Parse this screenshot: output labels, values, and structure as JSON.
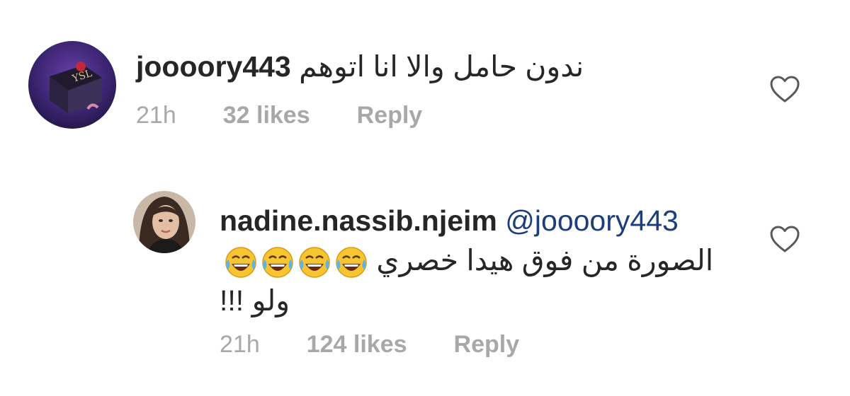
{
  "comments": [
    {
      "username": "joooory443",
      "text": "ندون حامل والا انا اتوهم",
      "time": "21h",
      "likes": "32 likes",
      "reply": "Reply"
    },
    {
      "username": "nadine.nassib.njeim",
      "mention": "@joooory443",
      "text_line1": "الصورة من فوق هيدا خصري",
      "text_line2": "ولو !!!",
      "emoji_count": 4,
      "emoji": "face-with-tears-of-joy",
      "time": "21h",
      "likes": "124 likes",
      "reply": "Reply"
    }
  ],
  "icons": {
    "like": "heart-outline-icon"
  }
}
